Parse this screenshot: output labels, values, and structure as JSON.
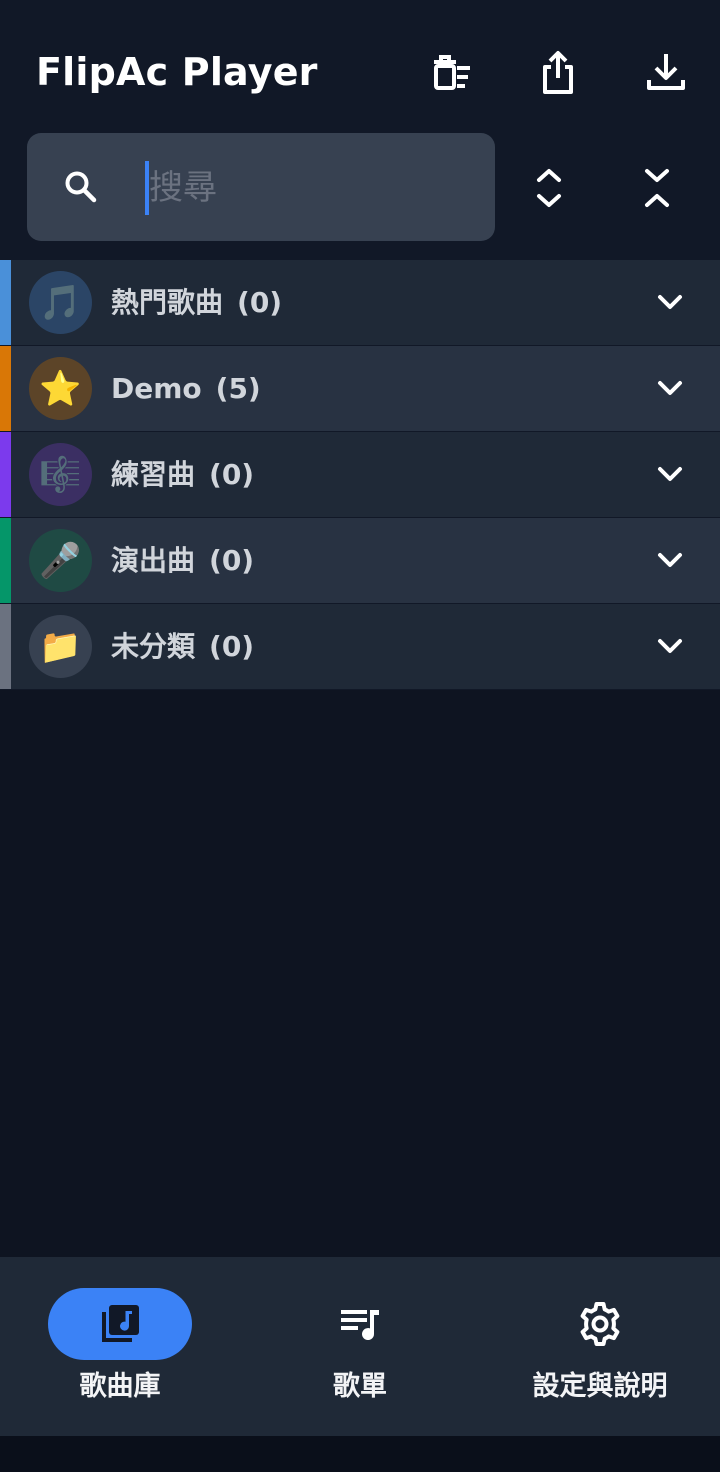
{
  "header": {
    "title": "FlipAc Player",
    "actions": [
      {
        "name": "clear-list-icon"
      },
      {
        "name": "share-icon"
      },
      {
        "name": "download-icon"
      }
    ]
  },
  "search": {
    "placeholder": "搜尋",
    "value": ""
  },
  "controls": {
    "expand_all_icon": "unfold-more-icon",
    "collapse_all_icon": "unfold-less-icon"
  },
  "categories": [
    {
      "label": "熱門歌曲",
      "count": "(0)",
      "emoji": "🎵",
      "stripe_color": "#4a90d9",
      "avatar_bg": "#2b4566"
    },
    {
      "label": "Demo",
      "count": "(5)",
      "emoji": "⭐",
      "stripe_color": "#d97706",
      "avatar_bg": "#5c4428"
    },
    {
      "label": "練習曲",
      "count": "(0)",
      "emoji": "🎼",
      "stripe_color": "#7c3aed",
      "avatar_bg": "#3b2f63"
    },
    {
      "label": "演出曲",
      "count": "(0)",
      "emoji": "🎤",
      "stripe_color": "#059669",
      "avatar_bg": "#1f4a44"
    },
    {
      "label": "未分類",
      "count": "(0)",
      "emoji": "📁",
      "stripe_color": "#6b7280",
      "avatar_bg": "#374151"
    }
  ],
  "bottom_nav": [
    {
      "label": "歌曲庫",
      "icon": "library-music-icon",
      "active": true
    },
    {
      "label": "歌單",
      "icon": "playlist-music-icon",
      "active": false
    },
    {
      "label": "設定與說明",
      "icon": "settings-icon",
      "active": false
    }
  ],
  "colors": {
    "accent": "#3b82f6",
    "background": "#0e1421",
    "surface": "#1f2937"
  }
}
